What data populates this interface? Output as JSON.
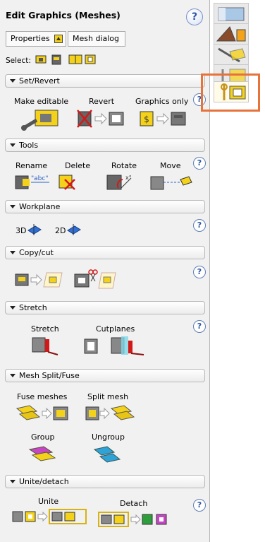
{
  "header": {
    "title": "Edit Graphics (Meshes)",
    "help": "?"
  },
  "tabs": {
    "properties": "Properties",
    "mesh_dialog": "Mesh dialog"
  },
  "select": {
    "label": "Select:"
  },
  "sections": {
    "set_revert": {
      "title": "Set/Revert",
      "items": [
        "Make editable",
        "Revert",
        "Graphics only"
      ]
    },
    "tools": {
      "title": "Tools",
      "items": [
        "Rename",
        "Delete",
        "Rotate",
        "Move"
      ],
      "rename_text": "\"abc\""
    },
    "workplane": {
      "title": "Workplane",
      "items": [
        "3D",
        "2D"
      ]
    },
    "copy_cut": {
      "title": "Copy/cut"
    },
    "stretch": {
      "title": "Stretch",
      "items": [
        "Stretch",
        "Cutplanes"
      ]
    },
    "mesh_split_fuse": {
      "title": "Mesh Split/Fuse",
      "items": [
        "Fuse meshes",
        "Split mesh",
        "Group",
        "Ungroup"
      ]
    },
    "unite_detach": {
      "title": "Unite/detach",
      "items": [
        "Unite",
        "Detach"
      ]
    }
  },
  "help_mark": "?",
  "colors": {
    "accent_yellow": "#f5d21a",
    "highlight_orange": "#e8733a",
    "help_blue": "#2c56a6"
  }
}
